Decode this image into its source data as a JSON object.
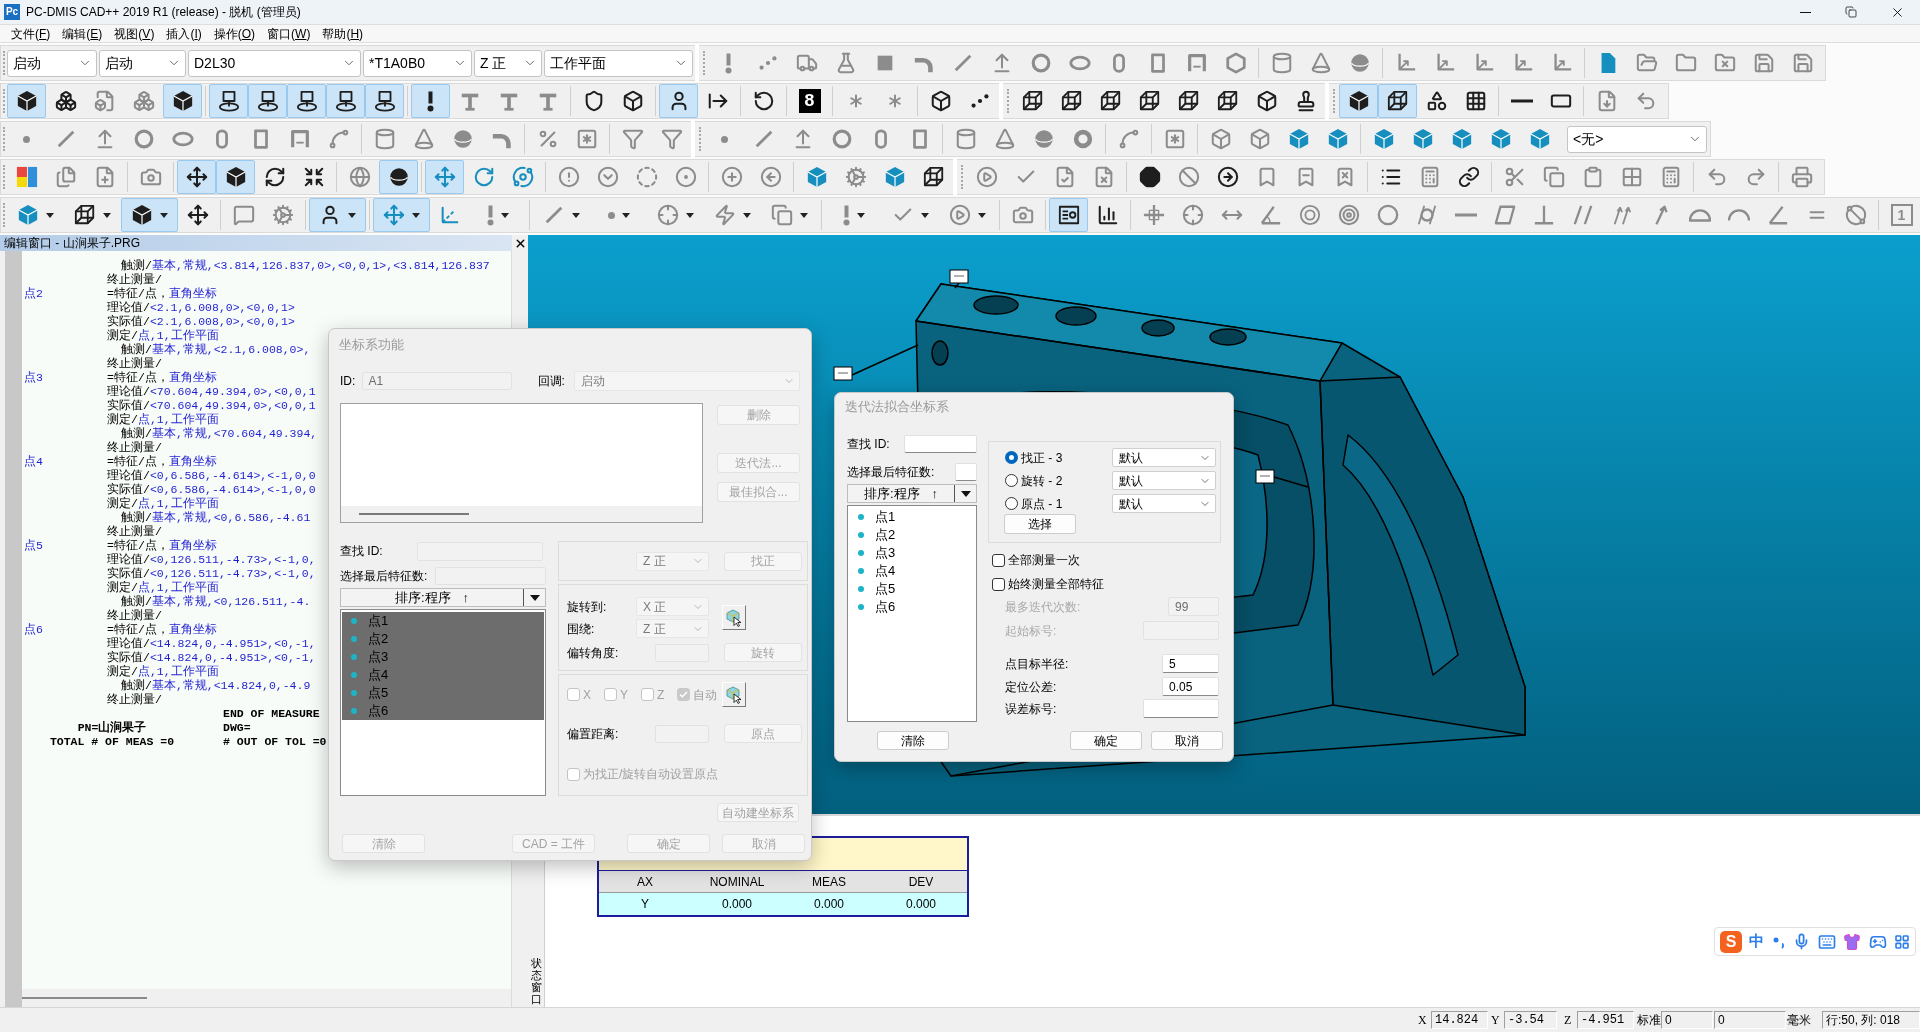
{
  "title_bar": {
    "logo": "Pc",
    "title": "PC-DMIS CAD++ 2019 R1 (release) - 脱机 (管理员)"
  },
  "menu": [
    "文件(F)",
    "编辑(E)",
    "视图(V)",
    "插入(I)",
    "操作(O)",
    "窗口(W)",
    "帮助(H)"
  ],
  "toolbar_rows": [
    {
      "combos_before": [
        "启动",
        "启动",
        "D2L30",
        "*T1A0B0",
        "Z 正",
        "工作平面"
      ],
      "buttons": [
        {
          "selected": false
        },
        {
          "selected": false
        },
        {
          "selected": false
        },
        {
          "selected": false
        },
        {
          "selected": false
        },
        {
          "selected": false
        },
        {
          "selected": false
        },
        {
          "selected": false
        },
        {
          "selected": false
        },
        {
          "selected": false
        },
        {
          "selected": false
        },
        {
          "selected": false
        },
        {
          "selected": false
        },
        {
          "selected": false
        },
        {
          "selected": false
        },
        {
          "selected": false
        },
        {
          "selected": false
        },
        {
          "selected": false
        },
        {
          "selected": false
        },
        {
          "selected": false
        },
        {
          "selected": false
        },
        {
          "selected": false
        },
        {
          "selected": false
        },
        {
          "selected": false
        },
        {
          "selected": false
        },
        {
          "selected": false
        },
        {
          "selected": false
        },
        {
          "selected": false
        }
      ]
    },
    {
      "buttons": [
        {
          "selected": true
        },
        {
          "selected": false
        },
        {
          "selected": false
        },
        {
          "selected": false
        },
        {
          "selected": true
        },
        {
          "selected": true
        },
        {
          "selected": true
        },
        {
          "selected": true
        },
        {
          "selected": true
        },
        {
          "selected": true
        },
        {
          "selected": true
        },
        {
          "selected": false
        },
        {
          "selected": false
        },
        {
          "selected": false
        },
        {
          "selected": false
        },
        {
          "selected": false
        },
        {
          "selected": true
        },
        {
          "selected": false
        },
        {
          "selected": false
        },
        {
          "selected": false,
          "label": "8"
        },
        {
          "selected": false
        },
        {
          "selected": false
        },
        {
          "selected": false
        },
        {
          "selected": false
        },
        {
          "selected": false
        },
        {
          "selected": false
        },
        {
          "selected": false
        },
        {
          "selected": false
        },
        {
          "selected": false
        },
        {
          "selected": false
        },
        {
          "selected": false
        },
        {
          "selected": false
        },
        {
          "selected": true
        },
        {
          "selected": true
        },
        {
          "selected": false
        },
        {
          "selected": false
        },
        {
          "selected": false
        },
        {
          "selected": false
        },
        {
          "selected": false
        },
        {
          "selected": false
        }
      ]
    },
    {
      "buttons": [
        {
          "selected": false
        },
        {
          "selected": false
        },
        {
          "selected": false
        },
        {
          "selected": false
        },
        {
          "selected": false
        },
        {
          "selected": false
        },
        {
          "selected": false
        },
        {
          "selected": false
        },
        {
          "selected": false
        },
        {
          "selected": false
        },
        {
          "selected": false
        },
        {
          "selected": false
        },
        {
          "selected": false
        },
        {
          "selected": false
        },
        {
          "selected": false
        },
        {
          "selected": false
        },
        {
          "selected": false
        },
        {
          "selected": false
        },
        {
          "selected": false
        },
        {
          "selected": false
        },
        {
          "selected": false
        },
        {
          "selected": false
        },
        {
          "selected": false
        },
        {
          "selected": false
        },
        {
          "selected": false
        },
        {
          "selected": false
        },
        {
          "selected": false
        },
        {
          "selected": false
        },
        {
          "selected": false
        },
        {
          "selected": false
        },
        {
          "selected": false
        },
        {
          "selected": false
        },
        {
          "selected": false
        },
        {
          "selected": false
        },
        {
          "selected": false
        },
        {
          "selected": false
        },
        {
          "selected": false
        },
        {
          "selected": false
        }
      ],
      "combos_after": [
        "<无>"
      ]
    },
    {
      "buttons": [
        {
          "selected": false
        },
        {
          "selected": false
        },
        {
          "selected": false
        },
        {
          "selected": false
        },
        {
          "selected": true
        },
        {
          "selected": true
        },
        {
          "selected": false
        },
        {
          "selected": false
        },
        {
          "selected": false
        },
        {
          "selected": true
        },
        {
          "selected": true
        },
        {
          "selected": false
        },
        {
          "selected": false
        },
        {
          "selected": false
        },
        {
          "selected": false
        },
        {
          "selected": false
        },
        {
          "selected": false
        },
        {
          "selected": false
        },
        {
          "selected": false
        },
        {
          "selected": false
        },
        {
          "selected": false
        },
        {
          "selected": false
        },
        {
          "selected": false
        },
        {
          "selected": false
        },
        {
          "selected": false
        },
        {
          "selected": false
        },
        {
          "selected": false
        },
        {
          "selected": false
        },
        {
          "selected": false
        },
        {
          "selected": false
        },
        {
          "selected": false
        },
        {
          "selected": false
        },
        {
          "selected": false
        },
        {
          "selected": false
        },
        {
          "selected": false
        },
        {
          "selected": false
        },
        {
          "selected": false
        },
        {
          "selected": false
        },
        {
          "selected": false
        },
        {
          "selected": false
        },
        {
          "selected": false
        },
        {
          "selected": false
        },
        {
          "selected": false
        },
        {
          "selected": false
        }
      ]
    },
    {
      "buttons": [
        {
          "selected": false
        },
        {
          "selected": false
        },
        {
          "selected": true
        },
        {
          "selected": false
        },
        {
          "selected": false
        },
        {
          "selected": false
        },
        {
          "selected": true
        },
        {
          "selected": true
        },
        {
          "selected": false
        },
        {
          "selected": false
        },
        {
          "selected": false
        },
        {
          "selected": false
        },
        {
          "selected": false
        },
        {
          "selected": false
        },
        {
          "selected": false
        },
        {
          "selected": false
        },
        {
          "selected": false
        },
        {
          "selected": false
        },
        {
          "selected": false
        },
        {
          "selected": true
        },
        {
          "selected": false
        },
        {
          "selected": false
        },
        {
          "selected": false
        },
        {
          "selected": false
        },
        {
          "selected": false
        },
        {
          "selected": false
        },
        {
          "selected": false
        },
        {
          "selected": false
        },
        {
          "selected": false
        },
        {
          "selected": false
        },
        {
          "selected": false
        },
        {
          "selected": false
        },
        {
          "selected": false
        },
        {
          "selected": false
        },
        {
          "selected": false
        },
        {
          "selected": false
        },
        {
          "selected": false
        },
        {
          "selected": false
        },
        {
          "selected": false
        },
        {
          "selected": false
        },
        {
          "selected": false,
          "label": "1"
        }
      ]
    }
  ],
  "editor": {
    "title": "编辑窗口 - 山涧果子.PRG",
    "lines": [
      {
        "kind": "hit",
        "keyword": "触测/",
        "args": "基本,常规,<3.814,126.837,0>,<0,0,1>,<3.814,126.837"
      },
      {
        "kind": "command",
        "keyword": "终止测量/"
      },
      {
        "kind": "command",
        "label": "点2",
        "keyword": "=特征/点，",
        "args": "直角坐标"
      },
      {
        "kind": "command",
        "keyword": "理论值/",
        "args": "<2.1,6.008,0>,<0,0,1>"
      },
      {
        "kind": "command",
        "keyword": "实际值/",
        "args": "<2.1,6.008,0>,<0,0,1>"
      },
      {
        "kind": "command",
        "keyword": "测定/",
        "args": "点,1,工作平面"
      },
      {
        "kind": "hit",
        "keyword": "触测/",
        "args": "基本,常规,<2.1,6.008,0>,"
      },
      {
        "kind": "command",
        "keyword": "终止测量/"
      },
      {
        "kind": "command",
        "label": "点3",
        "keyword": "=特征/点，",
        "args": "直角坐标"
      },
      {
        "kind": "command",
        "keyword": "理论值/",
        "args": "<70.604,49.394,0>,<0,0,1"
      },
      {
        "kind": "command",
        "keyword": "实际值/",
        "args": "<70.604,49.394,0>,<0,0,1"
      },
      {
        "kind": "command",
        "keyword": "测定/",
        "args": "点,1,工作平面"
      },
      {
        "kind": "hit",
        "keyword": "触测/",
        "args": "基本,常规,<70.604,49.394,"
      },
      {
        "kind": "command",
        "keyword": "终止测量/"
      },
      {
        "kind": "command",
        "label": "点4",
        "keyword": "=特征/点，",
        "args": "直角坐标"
      },
      {
        "kind": "command",
        "keyword": "理论值/",
        "args": "<0,6.586,-4.614>,<-1,0,0"
      },
      {
        "kind": "command",
        "keyword": "实际值/",
        "args": "<0,6.586,-4.614>,<-1,0,0"
      },
      {
        "kind": "command",
        "keyword": "测定/",
        "args": "点,1,工作平面"
      },
      {
        "kind": "hit",
        "keyword": "触测/",
        "args": "基本,常规,<0,6.586,-4.61"
      },
      {
        "kind": "command",
        "keyword": "终止测量/"
      },
      {
        "kind": "command",
        "label": "点5",
        "keyword": "=特征/点，",
        "args": "直角坐标"
      },
      {
        "kind": "command",
        "keyword": "理论值/",
        "args": "<0,126.511,-4.73>,<-1,0,"
      },
      {
        "kind": "command",
        "keyword": "实际值/",
        "args": "<0,126.511,-4.73>,<-1,0,"
      },
      {
        "kind": "command",
        "keyword": "测定/",
        "args": "点,1,工作平面"
      },
      {
        "kind": "hit",
        "keyword": "触测/",
        "args": "基本,常规,<0,126.511,-4."
      },
      {
        "kind": "command",
        "keyword": "终止测量/"
      },
      {
        "kind": "command",
        "label": "点6",
        "keyword": "=特征/点，",
        "args": "直角坐标"
      },
      {
        "kind": "command",
        "keyword": "理论值/",
        "args": "<14.824,0,-4.951>,<0,-1,"
      },
      {
        "kind": "command",
        "keyword": "实际值/",
        "args": "<14.824,0,-4.951>,<0,-1,"
      },
      {
        "kind": "command",
        "keyword": "测定/",
        "args": "点,1,工作平面"
      },
      {
        "kind": "hit",
        "keyword": "触测/",
        "args": "基本,常规,<14.824,0,-4.9"
      },
      {
        "kind": "command",
        "keyword": "终止测量/"
      }
    ],
    "report": [
      {
        "right": "END OF MEASURE"
      },
      {
        "left": "PN=山涧果子",
        "right": "DWG="
      },
      {
        "left": "TOTAL # OF MEAS =0",
        "right": "# OUT OF TOL =0"
      }
    ]
  },
  "coordinate_dialog": {
    "title": "坐标系功能",
    "disabled": true,
    "id": {
      "label": "ID:",
      "value": "A1"
    },
    "callback": {
      "label": "回调:",
      "value": "启动"
    },
    "side_buttons": [
      "删除",
      "迭代法...",
      "最佳拟合..."
    ],
    "find_id_label": "查找 ID:",
    "last_features_label": "选择最后特征数:",
    "sort": {
      "label": "排序:程序",
      "arrow": "↑"
    },
    "features": [
      {
        "name": "点1",
        "selected": true
      },
      {
        "name": "点2",
        "selected": true
      },
      {
        "name": "点3",
        "selected": true
      },
      {
        "name": "点4",
        "selected": true
      },
      {
        "name": "点5",
        "selected": true
      },
      {
        "name": "点6",
        "selected": true
      }
    ],
    "level_group": {
      "combo": "Z 正",
      "button": "找正"
    },
    "rotate_group": {
      "rotate_to": {
        "label": "旋转到:",
        "value": "X 正"
      },
      "about": {
        "label": "围绕:",
        "value": "Z 正"
      },
      "angle_label": "偏转角度:",
      "button": "旋转"
    },
    "origin_group": {
      "axes": [
        {
          "label": "X",
          "checked": false
        },
        {
          "label": "Y",
          "checked": false
        },
        {
          "label": "Z",
          "checked": false
        },
        {
          "label": "自动",
          "checked": true
        }
      ],
      "offset_label": "偏置距离:",
      "button": "原点",
      "auto_origin": {
        "label": "为找正/旋转自动设置原点",
        "checked": false
      }
    },
    "auto_button": "自动建坐标系",
    "footer_buttons": [
      "清除",
      "CAD = 工件",
      "确定",
      "取消"
    ]
  },
  "iterative_dialog": {
    "title": "迭代法拟合坐标系",
    "disabled": false,
    "find_id_label": "查找 ID:",
    "last_features_label": "选择最后特征数:",
    "sort": {
      "label": "排序:程序",
      "arrow": "↑"
    },
    "features": [
      {
        "name": "点1",
        "selected": false
      },
      {
        "name": "点2",
        "selected": false
      },
      {
        "name": "点3",
        "selected": false
      },
      {
        "name": "点4",
        "selected": false
      },
      {
        "name": "点5",
        "selected": false
      },
      {
        "name": "点6",
        "selected": false
      }
    ],
    "modes": [
      {
        "label": "找正 - 3",
        "selected": true,
        "combo": "默认"
      },
      {
        "label": "旋转 - 2",
        "selected": false,
        "combo": "默认"
      },
      {
        "label": "原点 - 1",
        "selected": false,
        "combo": "默认"
      }
    ],
    "select_button": "选择",
    "options": [
      {
        "label": "全部测量一次",
        "checked": false
      },
      {
        "label": "始终测量全部特征",
        "checked": false
      }
    ],
    "fields": [
      {
        "label": "最多迭代次数:",
        "value": "99",
        "disabled": true
      },
      {
        "label": "起始标号:",
        "disabled": true
      },
      {
        "label": "点目标半径:",
        "value": "5",
        "disabled": false
      },
      {
        "label": "定位公差:",
        "value": "0.05",
        "disabled": false
      },
      {
        "label": "误差标号:",
        "disabled": false
      }
    ],
    "footer_buttons": [
      "清除",
      "确定",
      "取消"
    ]
  },
  "status_dock": {
    "label": "状态窗口"
  },
  "report_table": {
    "columns": [
      "AX",
      "NOMINAL",
      "MEAS",
      "DEV"
    ],
    "rows": [
      [
        "Y",
        "0.000",
        "0.000",
        "0.000"
      ]
    ]
  },
  "ime_bar": {
    "logo": "S",
    "mode": "中"
  },
  "status_bar": {
    "coords": [
      {
        "axis": "X",
        "value": "14.824"
      },
      {
        "axis": "Y",
        "value": "-3.54"
      },
      {
        "axis": "Z",
        "value": "-4.951"
      }
    ],
    "mode_label": "标准",
    "mode": "0",
    "count": "0",
    "unit": "毫米",
    "position": "行:50, 列: 018"
  }
}
